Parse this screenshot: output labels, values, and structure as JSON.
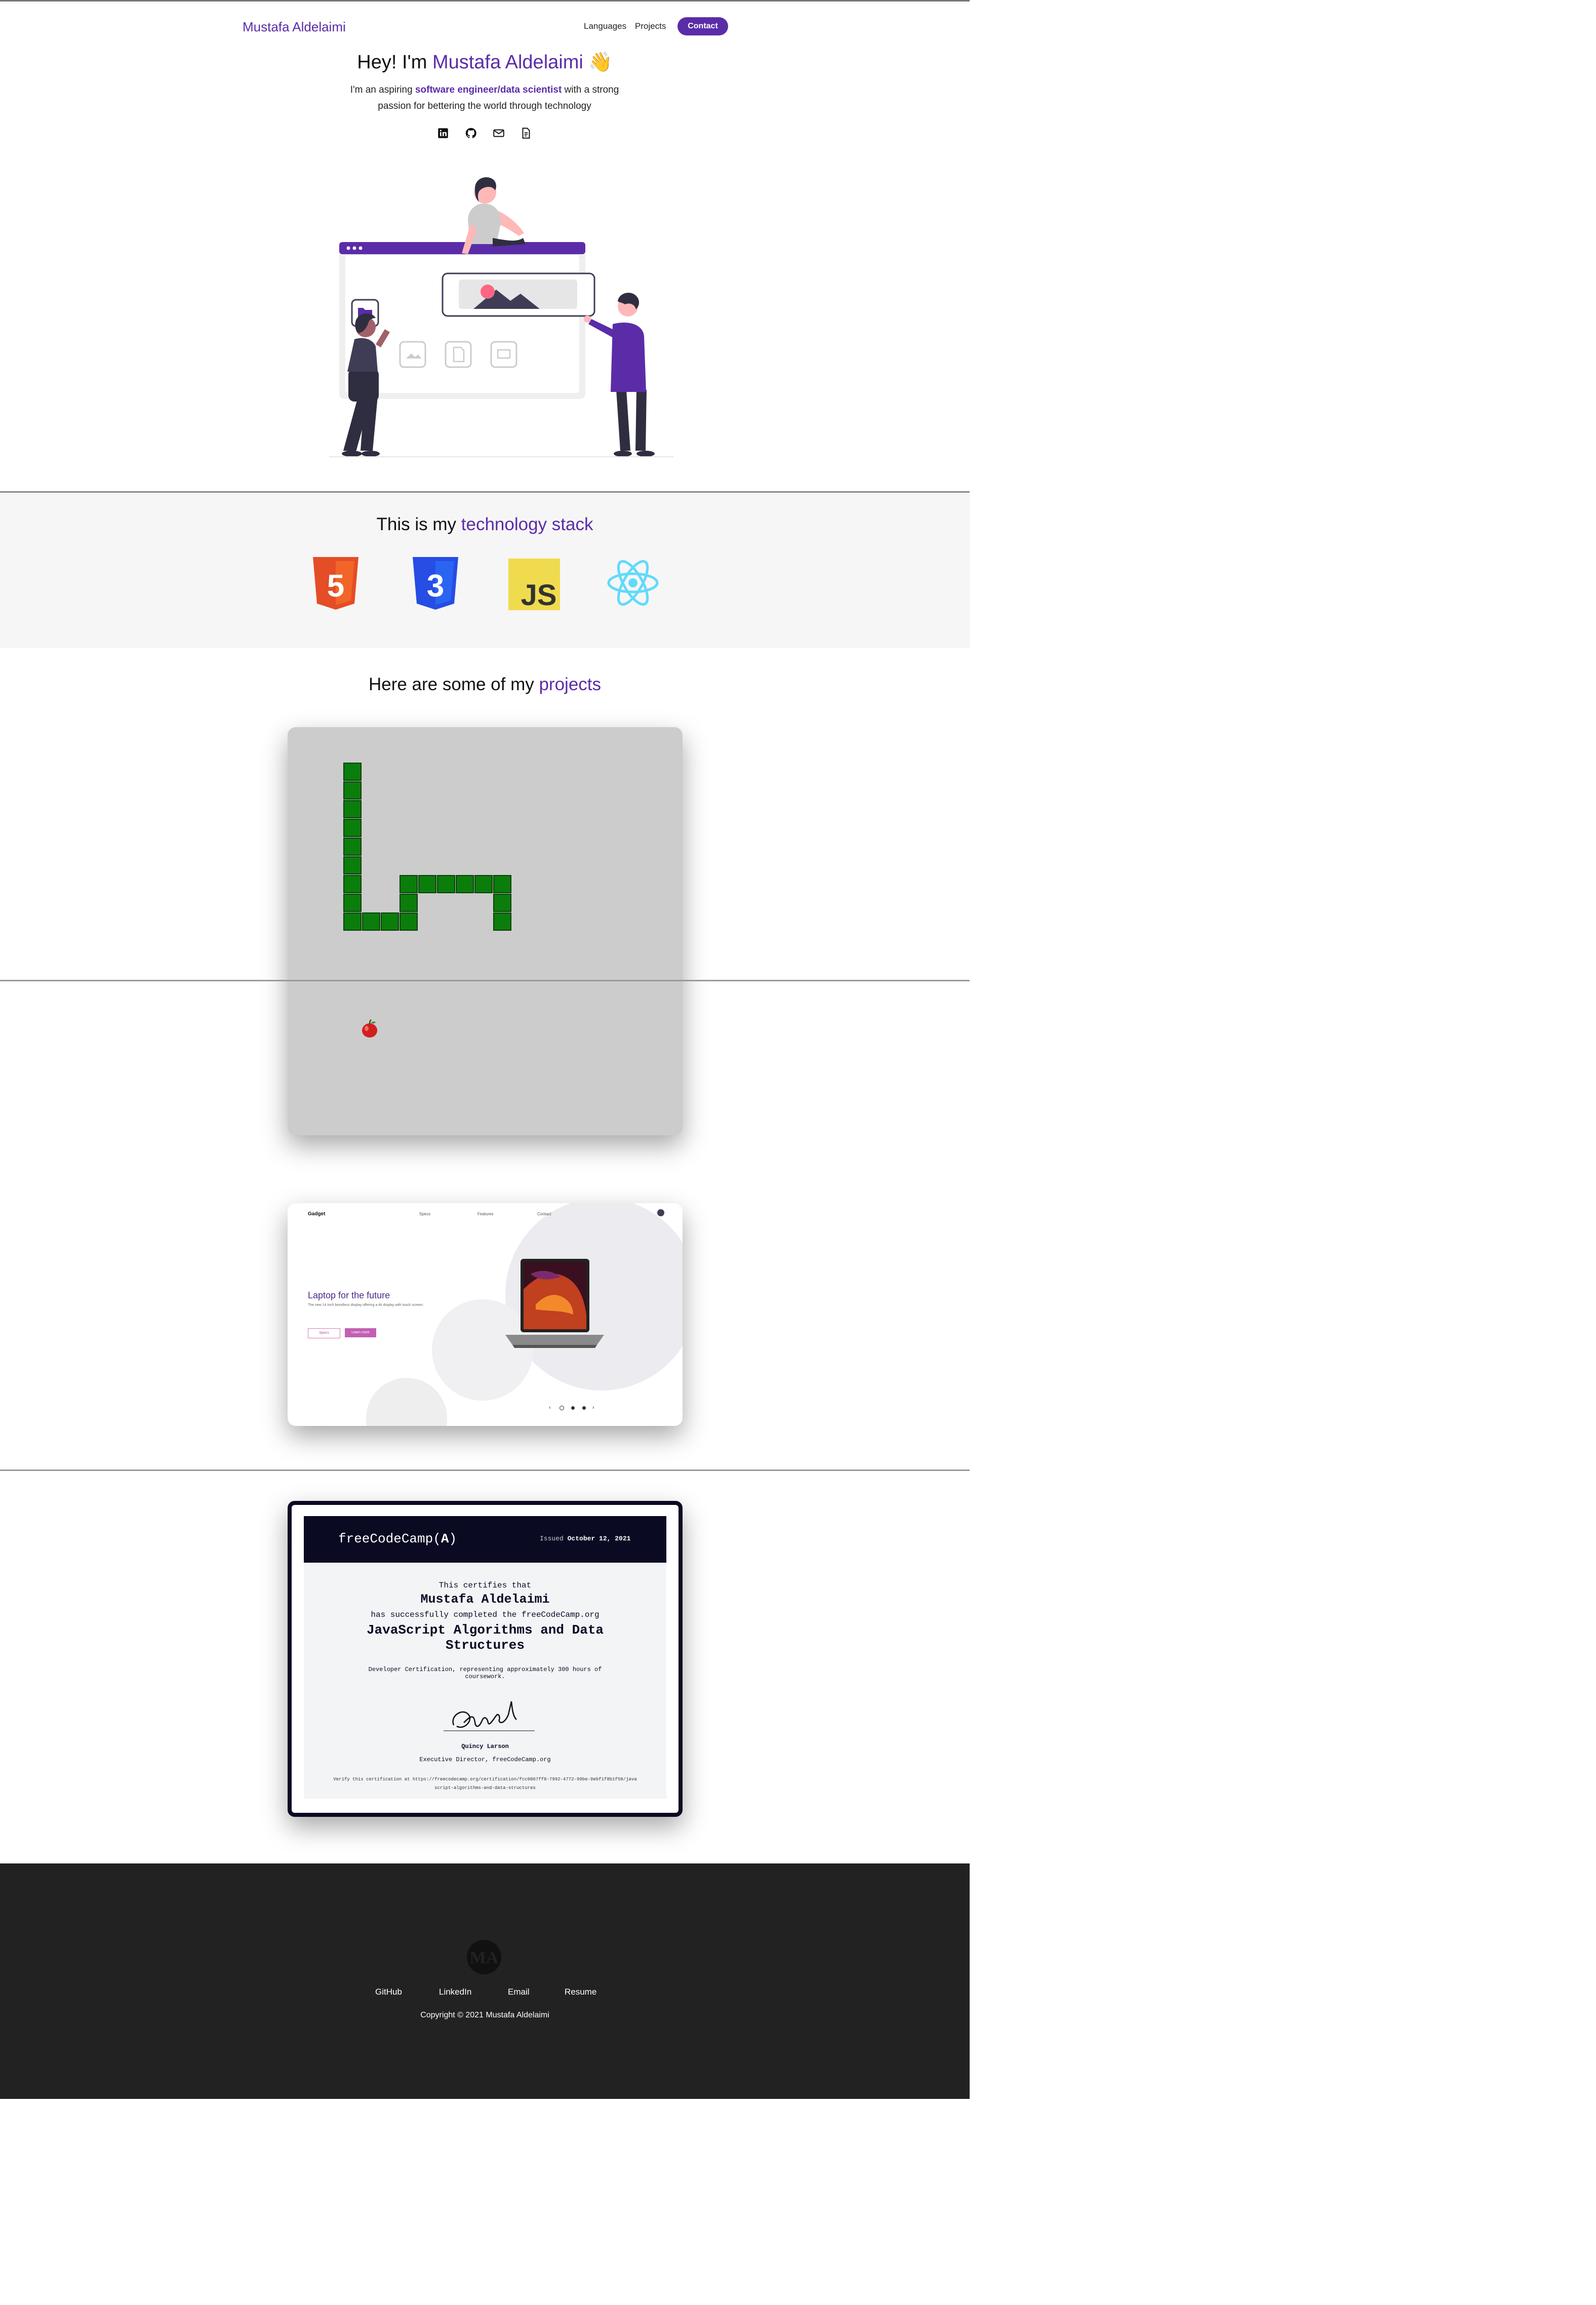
{
  "nav": {
    "brand": "Mustafa Aldelaimi",
    "links": [
      "Languages",
      "Projects"
    ],
    "contact": "Contact"
  },
  "hero": {
    "greeting": "Hey! I'm ",
    "name": "Mustafa Aldelaimi",
    "wave": "👋",
    "intro_before": "I'm an aspiring ",
    "intro_highlight": "software engineer/data scientist",
    "intro_after": " with a strong passion for bettering the world through technology",
    "social_icons": [
      "linkedin-icon",
      "github-icon",
      "email-icon",
      "resume-icon"
    ]
  },
  "stack": {
    "title_before": "This is my ",
    "title_highlight": "technology stack",
    "logos": [
      {
        "name": "html5",
        "label": "5",
        "color": "#e44d26"
      },
      {
        "name": "css3",
        "label": "3",
        "color": "#264de4"
      },
      {
        "name": "javascript",
        "label": "JS",
        "color": "#f0db4f"
      },
      {
        "name": "react",
        "label": "",
        "color": "#61dafb"
      }
    ]
  },
  "projects": {
    "title_before": "Here are some of my ",
    "title_highlight": "projects",
    "laptop": {
      "brand": "Gadget",
      "nav": [
        "Specs",
        "Features",
        "Contact"
      ],
      "headline": "Laptop for the future",
      "tagline": "The new 14 inch bezelless display offering a 4k display with touch screen.",
      "btn_primary": "Specs",
      "btn_secondary": "Learn more"
    },
    "cert": {
      "org": "freeCodeCamp(",
      "org_mark": "A",
      "org_end": ")",
      "issued_label": "Issued",
      "issued_date": "October 12, 2021",
      "certifies": "This certifies that",
      "recipient": "Mustafa Aldelaimi",
      "completed": "has successfully completed the freeCodeCamp.org",
      "course": "JavaScript Algorithms and Data Structures",
      "hours": "Developer Certification, representing approximately 300 hours of coursework.",
      "signer": "Quincy Larson",
      "signer_title": "Executive Director, freeCodeCamp.org",
      "verify": "Verify this certification at https://freecodecamp.org/certification/fcc0067ff8-7992-4772-99be-9ebf1f8b1f58/javascript-algorithms-and-data-structures"
    }
  },
  "footer": {
    "links": [
      "GitHub",
      "LinkedIn",
      "Email",
      "Resume"
    ],
    "copyright": "Copyright © 2021 Mustafa Aldelaimi",
    "logo_text": "MA"
  },
  "colors": {
    "accent": "#5b2ca8",
    "footer_bg": "#222222",
    "stack_bg": "#f6f6f6",
    "snake": "#0b7d0b"
  }
}
